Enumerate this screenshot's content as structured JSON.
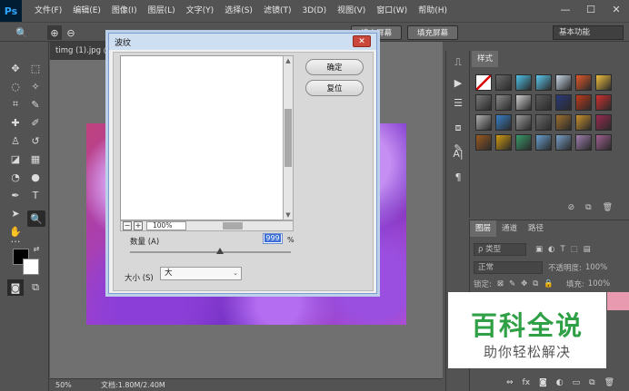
{
  "app": {
    "logo": "Ps",
    "menu": [
      "文件(F)",
      "编辑(E)",
      "图像(I)",
      "图层(L)",
      "文字(Y)",
      "选择(S)",
      "滤镜(T)",
      "3D(D)",
      "视图(V)",
      "窗口(W)",
      "帮助(H)"
    ],
    "window_controls": [
      "—",
      "☐",
      "✕"
    ]
  },
  "options_bar": {
    "buttons": [
      "填充屏幕",
      "填充屏幕"
    ],
    "workspace": "基本功能"
  },
  "document": {
    "tab_title": "timg (1).jpg @",
    "zoom": "50%",
    "doc_info": "文档:1.80M/2.40M"
  },
  "dialog": {
    "title": "波纹",
    "close": "✕",
    "ok_label": "确定",
    "reset_label": "复位",
    "preview_zoom": "100%",
    "zoom_minus": "−",
    "zoom_plus": "+",
    "amount_label": "数量 (A)",
    "amount_value": "999",
    "amount_unit": "%",
    "amount_fraction": 0.56,
    "size_label": "大小 (S)",
    "size_value": "大"
  },
  "styles_panel": {
    "tab": "样式",
    "swatches": [
      "none",
      "#6a6a6a",
      "#4fc3e8",
      "#5ec9f0",
      "#c9d8e8",
      "#e25a2a",
      "#f0c040",
      "#7a7a7a",
      "#8a8a8a",
      "#cfcfcf",
      "#5a5a5a",
      "#2b3a7a",
      "#c03a1a",
      "#d03030",
      "#b0b0b0",
      "#3a80c8",
      "#9a9a9a",
      "#6a6a6a",
      "#a07030",
      "#c89030",
      "#9a2a50",
      "#9a5a20",
      "#d09a10",
      "#3a9a6a",
      "#6aa0d0",
      "#7aa0c8",
      "#a080b0",
      "#a06090"
    ]
  },
  "layers_panel": {
    "tabs": [
      "图层",
      "通道",
      "路径"
    ],
    "kind_label": "ρ 类型",
    "blend_mode": "正常",
    "opacity_label": "不透明度:",
    "opacity_value": "100%",
    "lock_label": "锁定:",
    "fill_label": "填充:",
    "fill_value": "100%"
  },
  "watermark": {
    "title": "百科全说",
    "subtitle": "助你轻松解决"
  }
}
